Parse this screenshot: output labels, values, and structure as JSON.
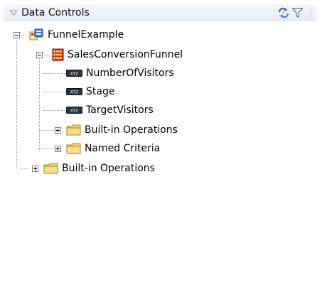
{
  "panel": {
    "title": "Data Controls",
    "collapse_icon": "collapse-triangle-icon",
    "refresh_icon": "refresh-icon",
    "filter_icon": "filter-icon"
  },
  "tree": {
    "root": {
      "label": "FunnelExample",
      "icon": "data-control-icon",
      "expanded": true,
      "children": {
        "collection": {
          "label": "SalesConversionFunnel",
          "icon": "collection-icon",
          "expanded": true,
          "attributes": [
            {
              "label": "NumberOfVisitors",
              "icon": "attribute-icon"
            },
            {
              "label": "Stage",
              "icon": "attribute-icon"
            },
            {
              "label": "TargetVisitors",
              "icon": "attribute-icon"
            }
          ],
          "folders": [
            {
              "label": "Built-in Operations",
              "icon": "folder-icon",
              "expanded": false
            },
            {
              "label": "Named Criteria",
              "icon": "folder-icon",
              "expanded": false
            }
          ]
        },
        "operations": {
          "label": "Built-in Operations",
          "icon": "folder-icon",
          "expanded": false
        }
      }
    }
  },
  "colors": {
    "header_bg": "#eef1f5",
    "folder": "#f2d571",
    "collection_red": "#d9261c",
    "attribute_dark": "#2b3440"
  }
}
